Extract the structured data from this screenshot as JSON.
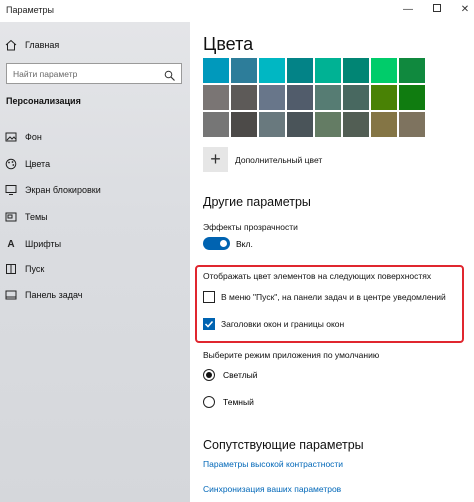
{
  "window": {
    "title": "Параметры"
  },
  "sidebar": {
    "home": "Главная",
    "search_placeholder": "Найти параметр",
    "section": "Персонализация",
    "items": [
      {
        "label": "Фон",
        "icon": "image-icon"
      },
      {
        "label": "Цвета",
        "icon": "palette-icon"
      },
      {
        "label": "Экран блокировки",
        "icon": "lock-screen-icon"
      },
      {
        "label": "Темы",
        "icon": "themes-icon"
      },
      {
        "label": "Шрифты",
        "icon": "font-icon"
      },
      {
        "label": "Пуск",
        "icon": "start-icon"
      },
      {
        "label": "Панель задач",
        "icon": "taskbar-icon"
      }
    ]
  },
  "main": {
    "title": "Цвета",
    "swatches": [
      [
        "#0099bc",
        "#2d7d9a",
        "#00b7c3",
        "#038387",
        "#00b294",
        "#018574",
        "#00cc6a",
        "#10893e"
      ],
      [
        "#7a7574",
        "#5d5a58",
        "#68768a",
        "#515c6b",
        "#567c73",
        "#486860",
        "#498205",
        "#107c10"
      ],
      [
        "#767676",
        "#4c4a48",
        "#69797e",
        "#4a5459",
        "#647c64",
        "#525e54",
        "#847545",
        "#7e735f"
      ]
    ],
    "add_color": "Дополнительный цвет",
    "other_params": "Другие параметры",
    "transparency_label": "Эффекты прозрачности",
    "transparency_state": "Вкл.",
    "surfaces_label": "Отображать цвет элементов на следующих поверхностях",
    "checkbox_start": "В меню \"Пуск\", на панели задач и в центре уведомлений",
    "checkbox_titles": "Заголовки окон и границы окон",
    "app_mode_label": "Выберите режим приложения по умолчанию",
    "mode_light": "Светлый",
    "mode_dark": "Темный",
    "related_title": "Сопутствующие параметры",
    "link_contrast": "Параметры высокой контрастности",
    "link_sync": "Синхронизация ваших параметров"
  },
  "colors": {
    "accent": "#0063b1",
    "link": "#0067b8",
    "highlight": "#e0262f"
  }
}
